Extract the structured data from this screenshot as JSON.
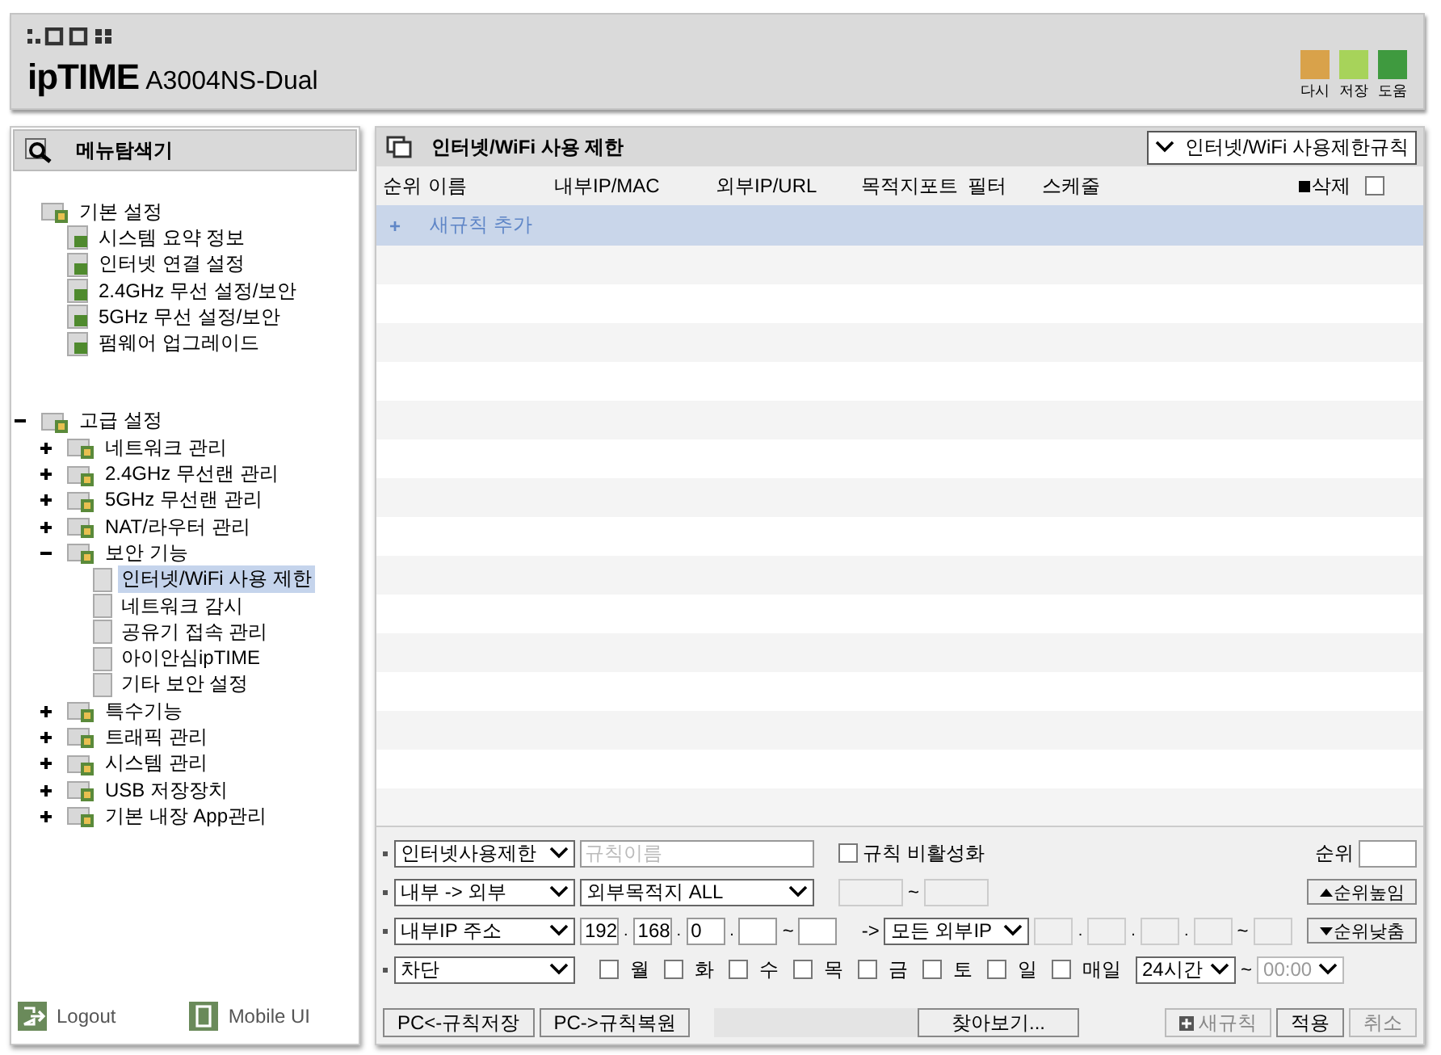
{
  "header": {
    "model": "A3004NS-Dual",
    "logo": "ipTIME",
    "actions": [
      {
        "kind": "undo",
        "label": "다시"
      },
      {
        "kind": "save",
        "label": "저장"
      },
      {
        "kind": "help",
        "label": "도움"
      }
    ]
  },
  "sidebar": {
    "title": "메뉴탐색기",
    "tree": [
      {
        "label": "기본 설정",
        "kind": "group",
        "selected": false,
        "children": [
          {
            "label": "시스템 요약 정보",
            "kind": "item",
            "selected": false
          },
          {
            "label": "인터넷 연결 설정",
            "kind": "item",
            "selected": false
          },
          {
            "label": "2.4GHz 무선 설정/보안",
            "kind": "item",
            "selected": false
          },
          {
            "label": "5GHz 무선 설정/보안",
            "kind": "item",
            "selected": false
          },
          {
            "label": "펌웨어 업그레이드",
            "kind": "item",
            "selected": false
          }
        ]
      },
      {
        "label": "고급 설정",
        "kind": "group",
        "selected": false,
        "expanded": true,
        "children": [
          {
            "label": "네트워크 관리",
            "kind": "group",
            "selected": false,
            "expanded": false
          },
          {
            "label": "2.4GHz 무선랜 관리",
            "kind": "group",
            "selected": false,
            "expanded": false
          },
          {
            "label": "5GHz 무선랜 관리",
            "kind": "group",
            "selected": false,
            "expanded": false
          },
          {
            "label": "NAT/라우터 관리",
            "kind": "group",
            "selected": false,
            "expanded": false
          },
          {
            "label": "보안 기능",
            "kind": "group",
            "selected": false,
            "expanded": true,
            "children": [
              {
                "label": "인터넷/WiFi 사용 제한",
                "kind": "plain",
                "selected": true
              },
              {
                "label": "네트워크 감시",
                "kind": "plain",
                "selected": false
              },
              {
                "label": "공유기 접속 관리",
                "kind": "plain",
                "selected": false
              },
              {
                "label": "아이안심ipTIME",
                "kind": "plain",
                "selected": false
              },
              {
                "label": "기타 보안 설정",
                "kind": "plain",
                "selected": false
              }
            ]
          },
          {
            "label": "특수기능",
            "kind": "group",
            "selected": false,
            "expanded": false
          },
          {
            "label": "트래픽 관리",
            "kind": "group",
            "selected": false,
            "expanded": false
          },
          {
            "label": "시스템 관리",
            "kind": "group",
            "selected": false,
            "expanded": false
          },
          {
            "label": "USB 저장장치",
            "kind": "group",
            "selected": false,
            "expanded": false
          },
          {
            "label": "기본 내장 App관리",
            "kind": "group",
            "selected": false,
            "expanded": false
          }
        ]
      }
    ],
    "footer": [
      {
        "kind": "logout",
        "label": "Logout"
      },
      {
        "kind": "mobile",
        "label": "Mobile UI"
      }
    ]
  },
  "main": {
    "title": "인터넷/WiFi 사용 제한",
    "rule_select": "인터넷/WiFi 사용제한규칙",
    "columns": [
      "순위",
      "이름",
      "내부IP/MAC",
      "외부IP/URL",
      "목적지포트",
      "필터",
      "스케줄"
    ],
    "delete_label": "삭제",
    "select_all_checked": false,
    "add_row": {
      "plus": "+",
      "label": "새규칙 추가"
    },
    "form": {
      "rule_type": "인터넷사용제한",
      "name_placeholder": "규칙이름",
      "disable": {
        "label": "규칙 비활성화",
        "checked": false
      },
      "priority_label": "순위",
      "direction": "내부 -> 외부",
      "destination": "외부목적지 ALL",
      "port_sep": "~",
      "raise_label": "순위높임",
      "ip_type": "내부IP 주소",
      "ip_octets": [
        "192",
        "168",
        "0"
      ],
      "ip_dots": [
        ".",
        ".",
        "."
      ],
      "ip_range_sep": "~",
      "arrow": "->",
      "ext_ip": "모든 외부IP",
      "ext_dots": [
        ".",
        ".",
        "."
      ],
      "ext_range_sep": "~",
      "lower_label": "순위낮춤",
      "action": "차단",
      "days": [
        {
          "label": "월",
          "checked": false
        },
        {
          "label": "화",
          "checked": false
        },
        {
          "label": "수",
          "checked": false
        },
        {
          "label": "목",
          "checked": false
        },
        {
          "label": "금",
          "checked": false
        },
        {
          "label": "토",
          "checked": false
        },
        {
          "label": "일",
          "checked": false
        },
        {
          "label": "매일",
          "checked": false
        }
      ],
      "time": "24시간",
      "time_sep": "~",
      "time_end": {
        "value": "00:00",
        "disabled": true
      }
    },
    "buttons": [
      {
        "kind": "save",
        "label": "PC<-규칙저장",
        "disabled": false
      },
      {
        "kind": "restore",
        "label": "PC->규칙복원",
        "disabled": false
      },
      {
        "kind": "browse",
        "label": "찾아보기...",
        "disabled": false
      },
      {
        "kind": "new",
        "label": "새규칙",
        "disabled": true
      },
      {
        "kind": "apply",
        "label": "적용",
        "disabled": false
      },
      {
        "kind": "cancel",
        "label": "취소",
        "disabled": true
      }
    ]
  }
}
